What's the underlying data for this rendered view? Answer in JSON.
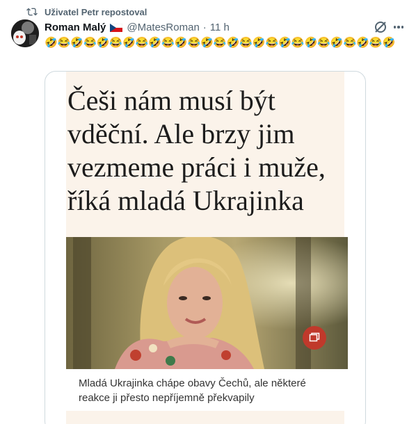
{
  "repost": {
    "label": "Uživatel Petr repostoval"
  },
  "post": {
    "author_name": "Roman Malý",
    "handle": "@MatesRoman",
    "separator": "·",
    "time": "11 h",
    "text": "🤣😂🤣😂🤣😂🤣😂🤣😂🤣😂🤣😂🤣😂🤣😂🤣😂🤣😂🤣😂🤣😂🤣"
  },
  "card": {
    "headline": "Češi nám musí být vděční. Ale brzy jim vezmeme práci i muže, říká mladá Ukrajinka",
    "caption": "Mladá Ukrajinka chápe obavy Čechů, ale některé reakce ji přesto nepříjemně překvapily"
  },
  "icons": {
    "repost": "repost-icon",
    "flag": "czech-flag-icon",
    "grok": "grok-icon",
    "more": "more-icon",
    "gallery": "gallery-icon"
  },
  "colors": {
    "secondary_text": "#536471",
    "card_background": "#fbf3ea",
    "gallery_button": "#c0392b"
  }
}
